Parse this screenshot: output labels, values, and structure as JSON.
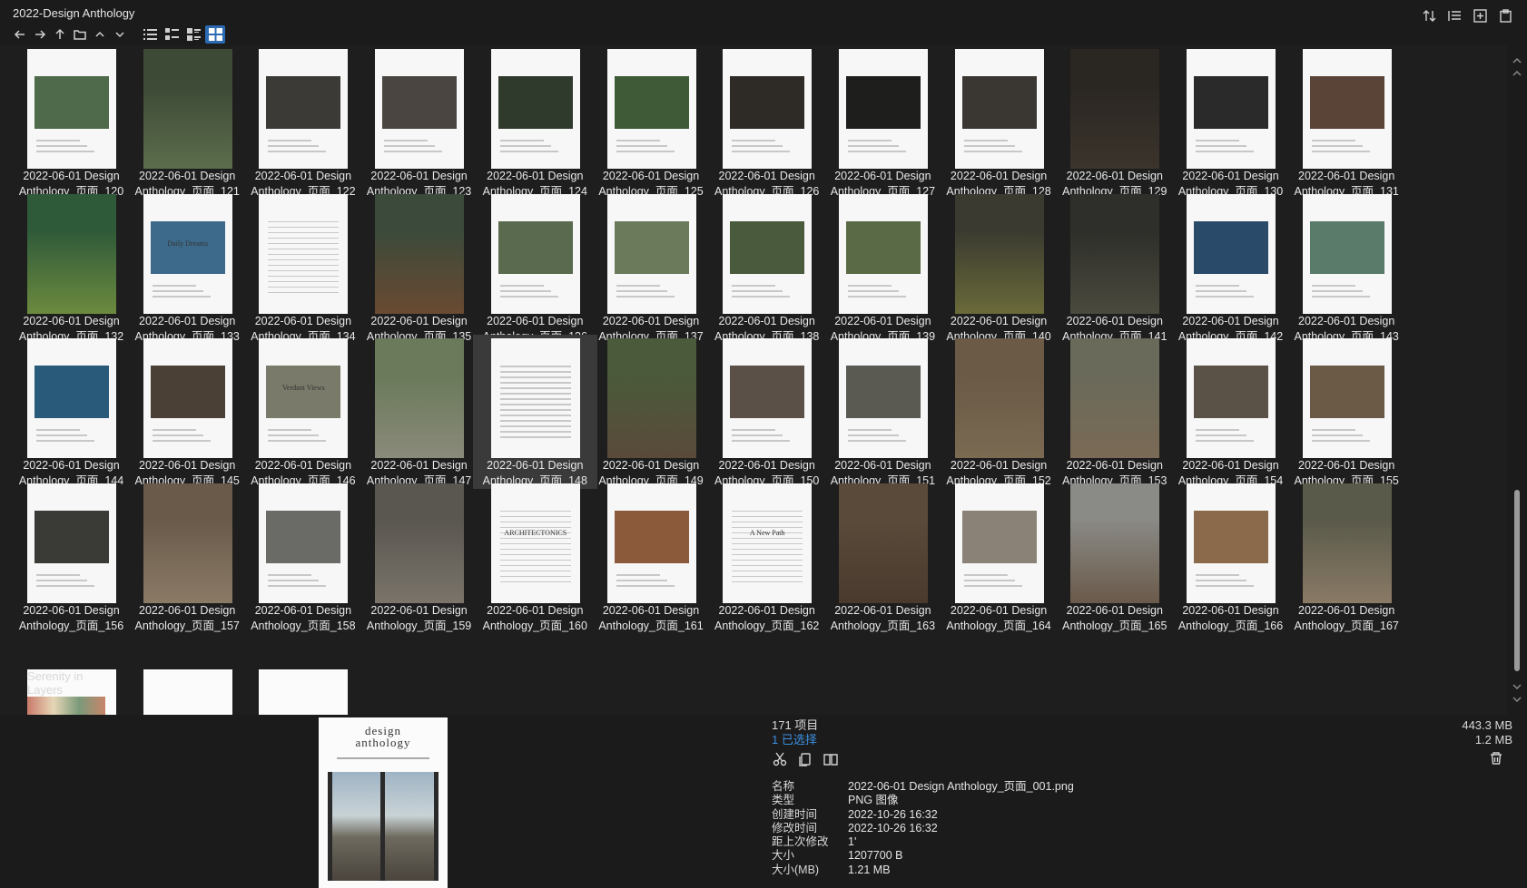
{
  "window": {
    "title": "2022-Design Anthology"
  },
  "grid": {
    "items": [
      {
        "line1": "2022-06-01 Design",
        "line2": "Anthology_页面_120",
        "bg": "#f7f7f7",
        "photo": "#4e6a4a"
      },
      {
        "line1": "2022-06-01 Design",
        "line2": "Anthology_页面_121",
        "bg": "#3d4a36",
        "photo": "#5c6d4c"
      },
      {
        "line1": "2022-06-01 Design",
        "line2": "Anthology_页面_122",
        "bg": "#f7f7f7",
        "photo": "#3b3a36"
      },
      {
        "line1": "2022-06-01 Design",
        "line2": "Anthology_页面_123",
        "bg": "#f7f7f7",
        "photo": "#4a4540"
      },
      {
        "line1": "2022-06-01 Design",
        "line2": "Anthology_页面_124",
        "bg": "#f7f7f7",
        "photo": "#2f3a2c"
      },
      {
        "line1": "2022-06-01 Design",
        "line2": "Anthology_页面_125",
        "bg": "#f7f7f7",
        "photo": "#3e5a36"
      },
      {
        "line1": "2022-06-01 Design",
        "line2": "Anthology_页面_126",
        "bg": "#f7f7f7",
        "photo": "#2e2a26"
      },
      {
        "line1": "2022-06-01 Design",
        "line2": "Anthology_页面_127",
        "bg": "#f7f7f7",
        "photo": "#1e1e1c"
      },
      {
        "line1": "2022-06-01 Design",
        "line2": "Anthology_页面_128",
        "bg": "#f7f7f7",
        "photo": "#3a3632"
      },
      {
        "line1": "2022-06-01 Design",
        "line2": "Anthology_页面_129",
        "bg": "#2a2622",
        "photo": "#3b342c"
      },
      {
        "line1": "2022-06-01 Design",
        "line2": "Anthology_页面_130",
        "bg": "#f7f7f7",
        "photo": "#2a2a2a"
      },
      {
        "line1": "2022-06-01 Design",
        "line2": "Anthology_页面_131",
        "bg": "#f7f7f7",
        "photo": "#5a4438"
      },
      {
        "line1": "2022-06-01 Design",
        "line2": "Anthology_页面_132",
        "bg": "#2f5a3a",
        "photo": "#6c8a3e"
      },
      {
        "line1": "2022-06-01 Design",
        "line2": "Anthology_页面_133",
        "bg": "#f7f7f7",
        "photo": "#3d6a8a"
      },
      {
        "line1": "2022-06-01 Design",
        "line2": "Anthology_页面_134",
        "bg": "#f7f7f7",
        "photo": "#f7f7f7"
      },
      {
        "line1": "2022-06-01 Design",
        "line2": "Anthology_页面_135",
        "bg": "#3b4a3a",
        "photo": "#6a4a32"
      },
      {
        "line1": "2022-06-01 Design",
        "line2": "Anthology_页面_136",
        "bg": "#f7f7f7",
        "photo": "#5a6a4e"
      },
      {
        "line1": "2022-06-01 Design",
        "line2": "Anthology_页面_137",
        "bg": "#f7f7f7",
        "photo": "#6a7a5a"
      },
      {
        "line1": "2022-06-01 Design",
        "line2": "Anthology_页面_138",
        "bg": "#f7f7f7",
        "photo": "#4a5a3c"
      },
      {
        "line1": "2022-06-01 Design",
        "line2": "Anthology_页面_139",
        "bg": "#f7f7f7",
        "photo": "#5a6a46"
      },
      {
        "line1": "2022-06-01 Design",
        "line2": "Anthology_页面_140",
        "bg": "#3a3a30",
        "photo": "#6a6a3a"
      },
      {
        "line1": "2022-06-01 Design",
        "line2": "Anthology_页面_141",
        "bg": "#2e2e2a",
        "photo": "#4a4a3e"
      },
      {
        "line1": "2022-06-01 Design",
        "line2": "Anthology_页面_142",
        "bg": "#f7f7f7",
        "photo": "#2a4a6a"
      },
      {
        "line1": "2022-06-01 Design",
        "line2": "Anthology_页面_143",
        "bg": "#f7f7f7",
        "photo": "#5a7a6a"
      },
      {
        "line1": "2022-06-01 Design",
        "line2": "Anthology_页面_144",
        "bg": "#f7f7f7",
        "photo": "#2a5a7a"
      },
      {
        "line1": "2022-06-01 Design",
        "line2": "Anthology_页面_145",
        "bg": "#f7f7f7",
        "photo": "#4a4036"
      },
      {
        "line1": "2022-06-01 Design",
        "line2": "Anthology_页面_146",
        "bg": "#f7f7f7",
        "photo": "#7a7a6a"
      },
      {
        "line1": "2022-06-01 Design",
        "line2": "Anthology_页面_147",
        "bg": "#6a7a5a",
        "photo": "#8a8a7a"
      },
      {
        "line1": "2022-06-01 Design",
        "line2": "Anthology_页面_148",
        "bg": "#f7f7f7",
        "photo": "#f7f7f7"
      },
      {
        "line1": "2022-06-01 Design",
        "line2": "Anthology_页面_149",
        "bg": "#4a5a3a",
        "photo": "#5a4a3a"
      },
      {
        "line1": "2022-06-01 Design",
        "line2": "Anthology_页面_150",
        "bg": "#f7f7f7",
        "photo": "#5a5048"
      },
      {
        "line1": "2022-06-01 Design",
        "line2": "Anthology_页面_151",
        "bg": "#f7f7f7",
        "photo": "#5a5a52"
      },
      {
        "line1": "2022-06-01 Design",
        "line2": "Anthology_页面_152",
        "bg": "#6a5a46",
        "photo": "#7a6a52"
      },
      {
        "line1": "2022-06-01 Design",
        "line2": "Anthology_页面_153",
        "bg": "#6a6a5a",
        "photo": "#7a6a56"
      },
      {
        "line1": "2022-06-01 Design",
        "line2": "Anthology_页面_154",
        "bg": "#f7f7f7",
        "photo": "#5a5246"
      },
      {
        "line1": "2022-06-01 Design",
        "line2": "Anthology_页面_155",
        "bg": "#f7f7f7",
        "photo": "#6a5a46"
      },
      {
        "line1": "2022-06-01 Design",
        "line2": "Anthology_页面_156",
        "bg": "#f7f7f7",
        "photo": "#3a3a36"
      },
      {
        "line1": "2022-06-01 Design",
        "line2": "Anthology_页面_157",
        "bg": "#6a5a4a",
        "photo": "#8a7a66"
      },
      {
        "line1": "2022-06-01 Design",
        "line2": "Anthology_页面_158",
        "bg": "#f7f7f7",
        "photo": "#6a6a66"
      },
      {
        "line1": "2022-06-01 Design",
        "line2": "Anthology_页面_159",
        "bg": "#5a5650",
        "photo": "#7a746a"
      },
      {
        "line1": "2022-06-01 Design",
        "line2": "Anthology_页面_160",
        "bg": "#f7f7f7",
        "photo": "#f7f7f7"
      },
      {
        "line1": "2022-06-01 Design",
        "line2": "Anthology_页面_161",
        "bg": "#f7f7f7",
        "photo": "#8a5a3a"
      },
      {
        "line1": "2022-06-01 Design",
        "line2": "Anthology_页面_162",
        "bg": "#f7f7f7",
        "photo": "#f7f7f7"
      },
      {
        "line1": "2022-06-01 Design",
        "line2": "Anthology_页面_163",
        "bg": "#5a4a3a",
        "photo": "#4a3a2e"
      },
      {
        "line1": "2022-06-01 Design",
        "line2": "Anthology_页面_164",
        "bg": "#f7f7f7",
        "photo": "#8a8276"
      },
      {
        "line1": "2022-06-01 Design",
        "line2": "Anthology_页面_165",
        "bg": "#8a8a86",
        "photo": "#6a5a4a"
      },
      {
        "line1": "2022-06-01 Design",
        "line2": "Anthology_页面_166",
        "bg": "#f7f7f7",
        "photo": "#8a6a4a"
      },
      {
        "line1": "2022-06-01 Design",
        "line2": "Anthology_页面_167",
        "bg": "#5a5a4a",
        "photo": "#8a7a66"
      }
    ],
    "selected_index": 28,
    "page_titles": {
      "133": "Daily Dreams",
      "146": "Verdant Views",
      "160": "ARCHITECTONICS",
      "162": "A New Path",
      "168": "Serenity in Layers"
    }
  },
  "preview": {
    "title_line1": "design",
    "title_line2": "anthology"
  },
  "info": {
    "item_count": "171 项目",
    "selected_count": "1 已选择",
    "total_size": "443.3 MB",
    "selected_size": "1.2 MB",
    "details": [
      {
        "key": "名称",
        "value": "2022-06-01 Design Anthology_页面_001.png"
      },
      {
        "key": "类型",
        "value": "PNG 图像"
      },
      {
        "key": "创建时间",
        "value": "2022-10-26  16:32"
      },
      {
        "key": "修改时间",
        "value": "2022-10-26  16:32"
      },
      {
        "key": "距上次修改",
        "value": "1'"
      },
      {
        "key": "大小",
        "value": "1207700 B"
      },
      {
        "key": "大小(MB)",
        "value": "1.21 MB"
      }
    ]
  },
  "colors": {
    "accent": "#2c6bb3",
    "selected_text": "#3d8fe0",
    "background": "#1e1e1e"
  }
}
